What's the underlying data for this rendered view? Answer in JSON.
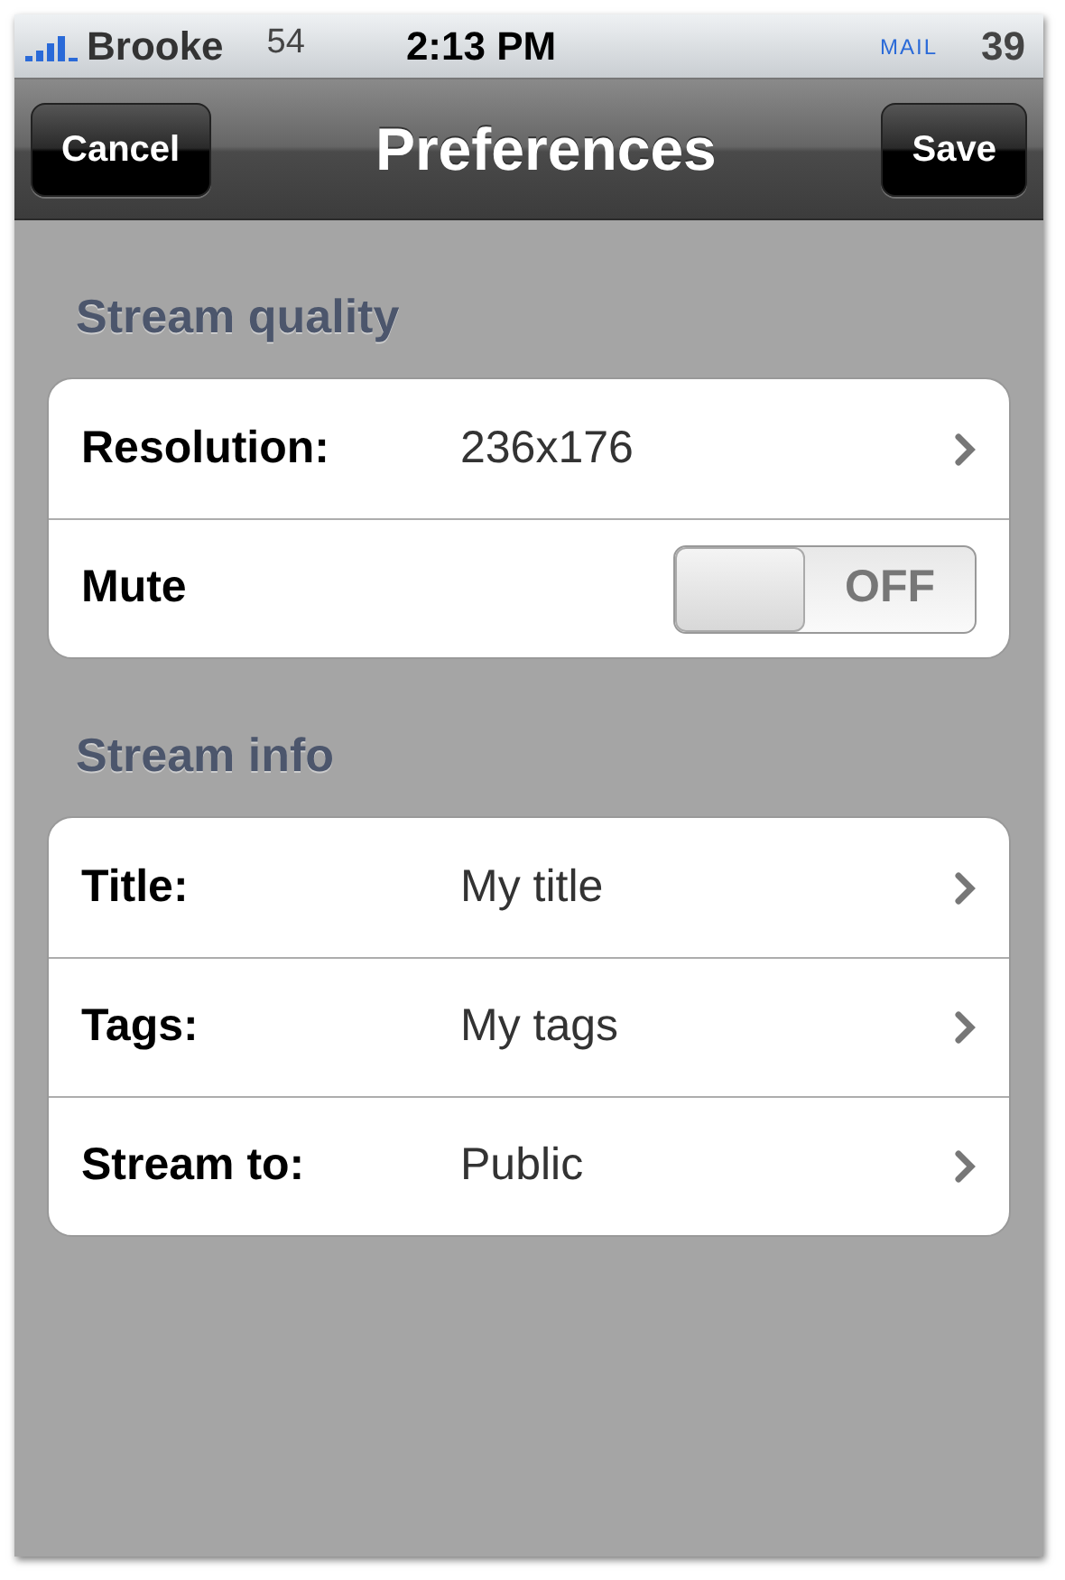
{
  "status_bar": {
    "carrier": "Brooke",
    "carrier_extra": "54",
    "time": "2:13 PM",
    "mail": "MAIL",
    "battery": "39"
  },
  "navbar": {
    "title": "Preferences",
    "left_button": "Cancel",
    "right_button": "Save"
  },
  "sections": [
    {
      "header": "Stream quality",
      "rows": [
        {
          "kind": "disclosure",
          "label": "Resolution:",
          "value": "236x176"
        },
        {
          "kind": "switch",
          "label": "Mute",
          "on": false,
          "switch_label": "OFF"
        }
      ]
    },
    {
      "header": "Stream info",
      "rows": [
        {
          "kind": "disclosure",
          "label": "Title:",
          "value": "My title"
        },
        {
          "kind": "disclosure",
          "label": "Tags:",
          "value": "My tags"
        },
        {
          "kind": "disclosure",
          "label": "Stream to:",
          "value": "Public"
        }
      ]
    }
  ]
}
